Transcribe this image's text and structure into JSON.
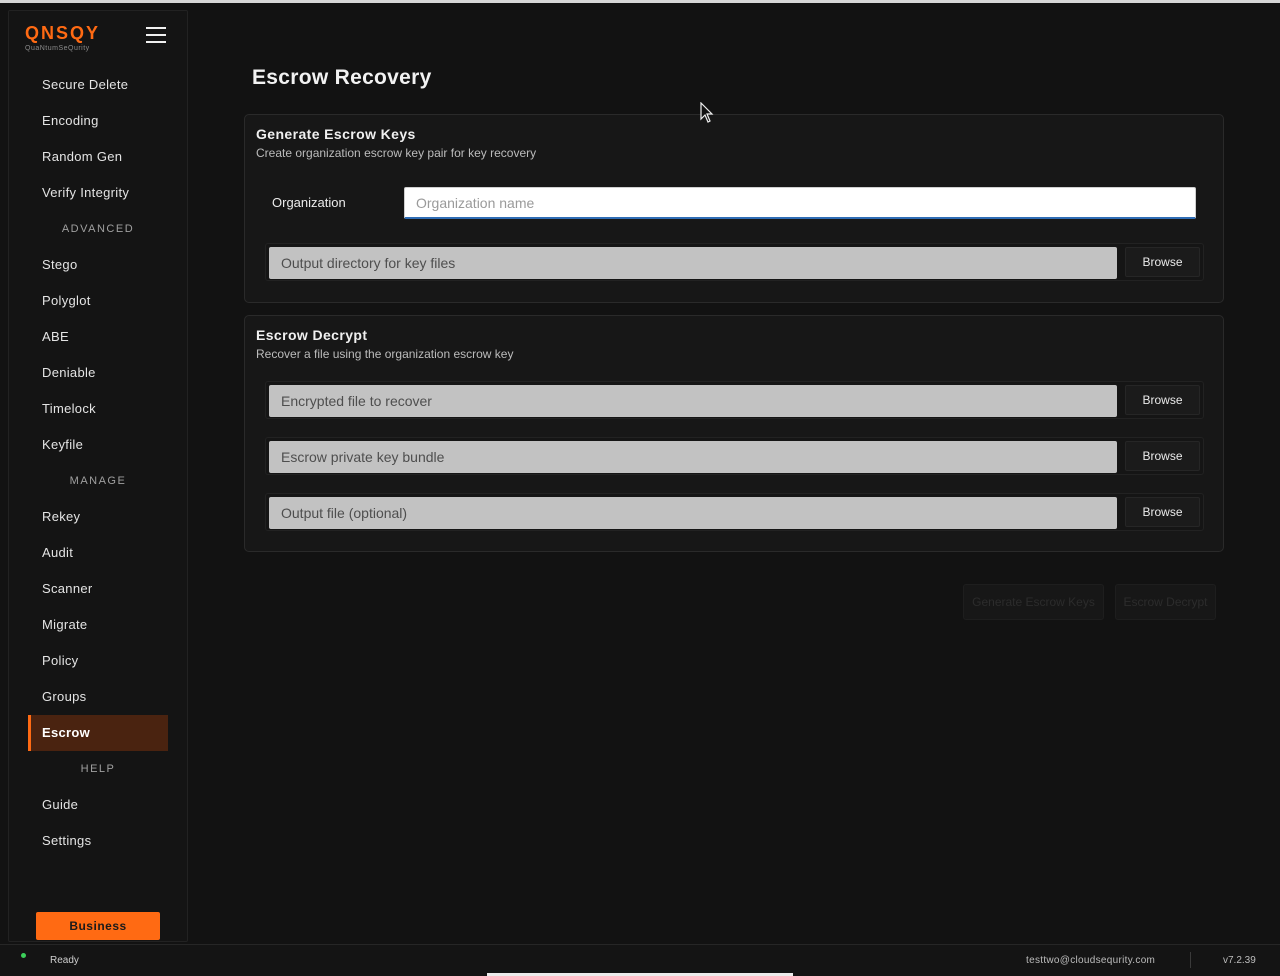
{
  "app": {
    "logo": "QNSQY",
    "logo_sub": "QuaNtumSeQurity"
  },
  "sidebar": {
    "items_top": [
      {
        "label": "Secure Delete"
      },
      {
        "label": "Encoding"
      },
      {
        "label": "Random Gen"
      },
      {
        "label": "Verify Integrity"
      }
    ],
    "section_advanced": "ADVANCED",
    "items_advanced": [
      {
        "label": "Stego"
      },
      {
        "label": "Polyglot"
      },
      {
        "label": "ABE"
      },
      {
        "label": "Deniable"
      },
      {
        "label": "Timelock"
      },
      {
        "label": "Keyfile"
      }
    ],
    "section_manage": "MANAGE",
    "items_manage": [
      {
        "label": "Rekey"
      },
      {
        "label": "Audit"
      },
      {
        "label": "Scanner"
      },
      {
        "label": "Migrate"
      },
      {
        "label": "Policy"
      },
      {
        "label": "Groups"
      },
      {
        "label": "Escrow",
        "active": true
      }
    ],
    "section_help": "HELP",
    "items_help": [
      {
        "label": "Guide"
      },
      {
        "label": "Settings"
      }
    ],
    "business_label": "Business",
    "accent_color": "#ff6a13"
  },
  "main": {
    "title": "Escrow Recovery",
    "generate": {
      "title": "Generate Escrow Keys",
      "subtitle": "Create organization escrow key pair for key recovery",
      "org_label": "Organization",
      "org_placeholder": "Organization name",
      "org_value": "",
      "output_dir_placeholder": "Output directory for key files",
      "browse_label": "Browse"
    },
    "decrypt": {
      "title": "Escrow Decrypt",
      "subtitle": "Recover a file using the organization escrow key",
      "encrypted_placeholder": "Encrypted file to recover",
      "private_key_placeholder": "Escrow private key bundle",
      "output_placeholder": "Output file (optional)",
      "browse_label": "Browse"
    },
    "actions": {
      "generate_label": "Generate Escrow Keys",
      "decrypt_label": "Escrow Decrypt"
    }
  },
  "status": {
    "state": "Ready",
    "user": "testtwo@cloudsequrity.com",
    "version": "v7.2.39"
  }
}
